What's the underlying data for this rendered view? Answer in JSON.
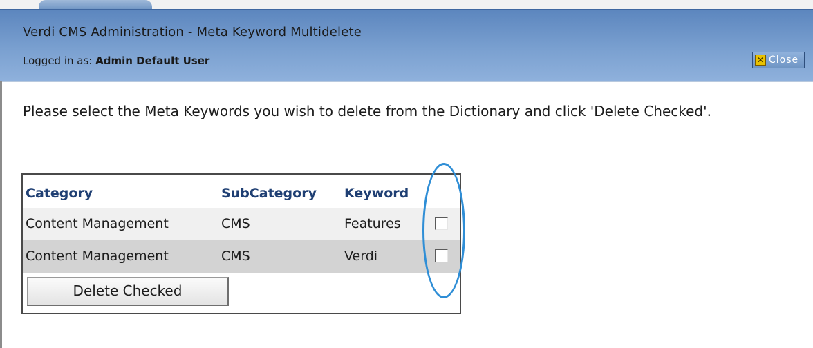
{
  "window": {
    "title": "Verdi CMS Administration - Meta Keyword Multidelete",
    "logged_in_prefix": "Logged in as:",
    "logged_in_user": "Admin Default User",
    "close_label": "Close",
    "close_icon": "x-icon"
  },
  "main": {
    "instructions": "Please select the Meta Keywords you wish to delete from the Dictionary and click 'Delete Checked'."
  },
  "table": {
    "headers": [
      "Category",
      "SubCategory",
      "Keyword"
    ],
    "rows": [
      {
        "category": "Content Management",
        "subcategory": "CMS",
        "keyword": "Features",
        "checked": false
      },
      {
        "category": "Content Management",
        "subcategory": "CMS",
        "keyword": "Verdi",
        "checked": false
      }
    ],
    "delete_button_label": "Delete Checked"
  },
  "colors": {
    "header_text": "#1f3f73",
    "titlebar": "#7aa0d0",
    "highlight_ring": "#2f8ed6"
  }
}
